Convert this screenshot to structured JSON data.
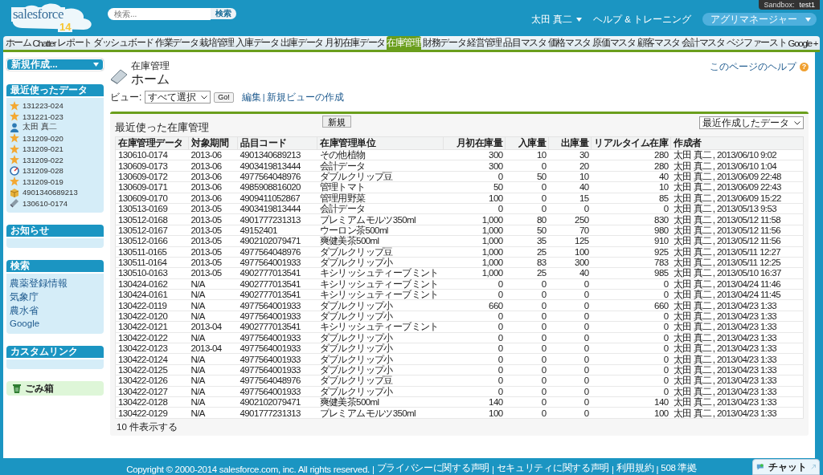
{
  "header": {
    "logo": {
      "wordmark": "salesforce",
      "version": "14"
    },
    "search": {
      "placeholder": "検索...",
      "button": "検索"
    },
    "sandbox": {
      "label": "Sandbox:",
      "name": "test1"
    },
    "user_menu": "太田 真二",
    "help": "ヘルプ & トレーニング",
    "app_menu": "アグリマネージャー"
  },
  "tabs": [
    {
      "label": "ホーム",
      "selected": false
    },
    {
      "label": "Chatter",
      "selected": false
    },
    {
      "label": "レポート",
      "selected": false
    },
    {
      "label": "ダッシュボード",
      "selected": false
    },
    {
      "label": "作業データ",
      "selected": false
    },
    {
      "label": "栽培管理",
      "selected": false
    },
    {
      "label": "入庫データ",
      "selected": false
    },
    {
      "label": "出庫データ",
      "selected": false
    },
    {
      "label": "月初在庫データ",
      "selected": false
    },
    {
      "label": "在庫管理",
      "selected": true
    },
    {
      "label": "財務データ",
      "selected": false
    },
    {
      "label": "経営管理",
      "selected": false
    },
    {
      "label": "品目マスタ",
      "selected": false
    },
    {
      "label": "価格マスタ",
      "selected": false
    },
    {
      "label": "原価マスタ",
      "selected": false
    },
    {
      "label": "顧客マスタ",
      "selected": false
    },
    {
      "label": "会計マスタ",
      "selected": false
    },
    {
      "label": "ベジファースト",
      "selected": false
    },
    {
      "label": "Google",
      "selected": false
    },
    {
      "label": "+",
      "selected": false
    }
  ],
  "sidebar": {
    "create_new": "新規作成...",
    "recent": {
      "title": "最近使ったデータ",
      "items": [
        {
          "kind": "record",
          "label": "131223-024"
        },
        {
          "kind": "record",
          "label": "131221-023"
        },
        {
          "kind": "user",
          "label": "太田 真二"
        },
        {
          "kind": "record",
          "label": "131209-020"
        },
        {
          "kind": "record",
          "label": "131209-021"
        },
        {
          "kind": "record",
          "label": "131209-022"
        },
        {
          "kind": "gauge",
          "label": "131209-028"
        },
        {
          "kind": "record",
          "label": "131209-019"
        },
        {
          "kind": "product",
          "label": "4901340689213"
        },
        {
          "kind": "inventory",
          "label": "130610-0174"
        }
      ]
    },
    "notices": {
      "title": "お知らせ"
    },
    "search": {
      "title": "検索",
      "links": [
        "農薬登録情報",
        "気象庁",
        "農水省",
        "Google"
      ]
    },
    "custom_links": {
      "title": "カスタムリンク"
    },
    "recycle_bin": "ごみ箱"
  },
  "main": {
    "breadcrumb": "在庫管理",
    "title": "ホーム",
    "help_link": "このページのヘルプ",
    "help_icon": "?",
    "view": {
      "label": "ビュー:",
      "selected": "すべて選択",
      "go": "Go!",
      "edit": "編集",
      "separator": "|",
      "new_view": "新規ビューの作成"
    },
    "recent_panel": {
      "title": "最近使った在庫管理",
      "new_button": "新規",
      "sort": "最近作成したデータ",
      "columns": [
        "在庫管理データ",
        "対象期間",
        "品目コード",
        "在庫管理単位",
        "月初在庫量",
        "入庫量",
        "出庫量",
        "リアルタイム在庫",
        "作成者"
      ],
      "rows": [
        {
          "id": "130610-0174",
          "period": "2013-06",
          "code": "4901340689213",
          "unit": "その他植物",
          "opening": "300",
          "in": "10",
          "out": "30",
          "realtime": "280",
          "creator": "太田 真二",
          "created": ", 2013/06/10 9:02"
        },
        {
          "id": "130609-0173",
          "period": "2013-06",
          "code": "4903419813444",
          "unit": "会計データ",
          "opening": "300",
          "in": "0",
          "out": "20",
          "realtime": "280",
          "creator": "太田 真二",
          "created": ", 2013/06/10 1:04"
        },
        {
          "id": "130609-0172",
          "period": "2013-06",
          "code": "4977564048976",
          "unit": "ダブルクリップ豆",
          "opening": "0",
          "in": "50",
          "out": "10",
          "realtime": "40",
          "creator": "太田 真二",
          "created": ", 2013/06/09 22:48"
        },
        {
          "id": "130609-0171",
          "period": "2013-06",
          "code": "4985908816020",
          "unit": "管理トマト",
          "opening": "50",
          "in": "0",
          "out": "40",
          "realtime": "10",
          "creator": "太田 真二",
          "created": ", 2013/06/09 22:43"
        },
        {
          "id": "130609-0170",
          "period": "2013-06",
          "code": "4909411052867",
          "unit": "管理用野菜",
          "opening": "100",
          "in": "0",
          "out": "15",
          "realtime": "85",
          "creator": "太田 真二",
          "created": ", 2013/06/09 15:22"
        },
        {
          "id": "130513-0169",
          "period": "2013-05",
          "code": "4903419813444",
          "unit": "会計データ",
          "opening": "0",
          "in": "0",
          "out": "0",
          "realtime": "0",
          "creator": "太田 真二",
          "created": ", 2013/05/13 9:53"
        },
        {
          "id": "130512-0168",
          "period": "2013-05",
          "code": "4901777231313",
          "unit": "プレミアムモルツ350ml",
          "opening": "1,000",
          "in": "80",
          "out": "250",
          "realtime": "830",
          "creator": "太田 真二",
          "created": ", 2013/05/12 11:58"
        },
        {
          "id": "130512-0167",
          "period": "2013-05",
          "code": "49152401",
          "unit": "ウーロン茶500ml",
          "opening": "1,000",
          "in": "50",
          "out": "70",
          "realtime": "980",
          "creator": "太田 真二",
          "created": ", 2013/05/12 11:56"
        },
        {
          "id": "130512-0166",
          "period": "2013-05",
          "code": "4902102079471",
          "unit": "爽健美茶500ml",
          "opening": "1,000",
          "in": "35",
          "out": "125",
          "realtime": "910",
          "creator": "太田 真二",
          "created": ", 2013/05/12 11:56"
        },
        {
          "id": "130511-0165",
          "period": "2013-05",
          "code": "4977564048976",
          "unit": "ダブルクリップ豆",
          "opening": "1,000",
          "in": "25",
          "out": "100",
          "realtime": "925",
          "creator": "太田 真二",
          "created": ", 2013/05/11 12:27"
        },
        {
          "id": "130511-0164",
          "period": "2013-05",
          "code": "4977564001933",
          "unit": "ダブルクリップ小",
          "opening": "1,000",
          "in": "83",
          "out": "300",
          "realtime": "783",
          "creator": "太田 真二",
          "created": ", 2013/05/11 12:25"
        },
        {
          "id": "130510-0163",
          "period": "2013-05",
          "code": "4902777013541",
          "unit": "キシリッシュティーブミント",
          "opening": "1,000",
          "in": "25",
          "out": "40",
          "realtime": "985",
          "creator": "太田 真二",
          "created": ", 2013/05/10 16:37"
        },
        {
          "id": "130424-0162",
          "period": "N/A",
          "code": "4902777013541",
          "unit": "キシリッシュティーブミント",
          "opening": "0",
          "in": "0",
          "out": "0",
          "realtime": "0",
          "creator": "太田 真二",
          "created": ", 2013/04/24 11:46"
        },
        {
          "id": "130424-0161",
          "period": "N/A",
          "code": "4902777013541",
          "unit": "キシリッシュティーブミント",
          "opening": "0",
          "in": "0",
          "out": "0",
          "realtime": "0",
          "creator": "太田 真二",
          "created": ", 2013/04/24 11:45"
        },
        {
          "id": "130422-0119",
          "period": "N/A",
          "code": "4977564001933",
          "unit": "ダブルクリップ小",
          "opening": "660",
          "in": "0",
          "out": "0",
          "realtime": "660",
          "creator": "太田 真二",
          "created": ", 2013/04/23 1:33"
        },
        {
          "id": "130422-0120",
          "period": "N/A",
          "code": "4977564001933",
          "unit": "ダブルクリップ小",
          "opening": "0",
          "in": "0",
          "out": "0",
          "realtime": "0",
          "creator": "太田 真二",
          "created": ", 2013/04/23 1:33"
        },
        {
          "id": "130422-0121",
          "period": "2013-04",
          "code": "4902777013541",
          "unit": "キシリッシュティーブミント",
          "opening": "0",
          "in": "0",
          "out": "0",
          "realtime": "0",
          "creator": "太田 真二",
          "created": ", 2013/04/23 1:33"
        },
        {
          "id": "130422-0122",
          "period": "N/A",
          "code": "4977564001933",
          "unit": "ダブルクリップ小",
          "opening": "0",
          "in": "0",
          "out": "0",
          "realtime": "0",
          "creator": "太田 真二",
          "created": ", 2013/04/23 1:33"
        },
        {
          "id": "130422-0123",
          "period": "2013-04",
          "code": "4977564001933",
          "unit": "ダブルクリップ小",
          "opening": "0",
          "in": "0",
          "out": "0",
          "realtime": "0",
          "creator": "太田 真二",
          "created": ", 2013/04/23 1:33"
        },
        {
          "id": "130422-0124",
          "period": "N/A",
          "code": "4977564001933",
          "unit": "ダブルクリップ小",
          "opening": "0",
          "in": "0",
          "out": "0",
          "realtime": "0",
          "creator": "太田 真二",
          "created": ", 2013/04/23 1:33"
        },
        {
          "id": "130422-0125",
          "period": "N/A",
          "code": "4977564001933",
          "unit": "ダブルクリップ小",
          "opening": "0",
          "in": "0",
          "out": "0",
          "realtime": "0",
          "creator": "太田 真二",
          "created": ", 2013/04/23 1:33"
        },
        {
          "id": "130422-0126",
          "period": "N/A",
          "code": "4977564048976",
          "unit": "ダブルクリップ豆",
          "opening": "0",
          "in": "0",
          "out": "0",
          "realtime": "0",
          "creator": "太田 真二",
          "created": ", 2013/04/23 1:33"
        },
        {
          "id": "130422-0127",
          "period": "N/A",
          "code": "4977564001933",
          "unit": "ダブルクリップ小",
          "opening": "0",
          "in": "0",
          "out": "0",
          "realtime": "0",
          "creator": "太田 真二",
          "created": ", 2013/04/23 1:33"
        },
        {
          "id": "130422-0128",
          "period": "N/A",
          "code": "4902102079471",
          "unit": "爽健美茶500ml",
          "opening": "140",
          "in": "0",
          "out": "0",
          "realtime": "140",
          "creator": "太田 真二",
          "created": ", 2013/04/23 1:33"
        },
        {
          "id": "130422-0129",
          "period": "N/A",
          "code": "4901777231313",
          "unit": "プレミアムモルツ350ml",
          "opening": "100",
          "in": "0",
          "out": "0",
          "realtime": "100",
          "creator": "太田 真二",
          "created": ", 2013/04/23 1:33"
        }
      ],
      "show_more": "10 件表示する"
    }
  },
  "footer": {
    "copyright": "Copyright © 2000-2014 salesforce.com, inc. All rights reserved.",
    "links": [
      "プライバシーに関する声明",
      "セキュリティに関する声明",
      "利用規約",
      "508 準拠"
    ],
    "separator": "|"
  },
  "chat": {
    "label": "チャット"
  }
}
